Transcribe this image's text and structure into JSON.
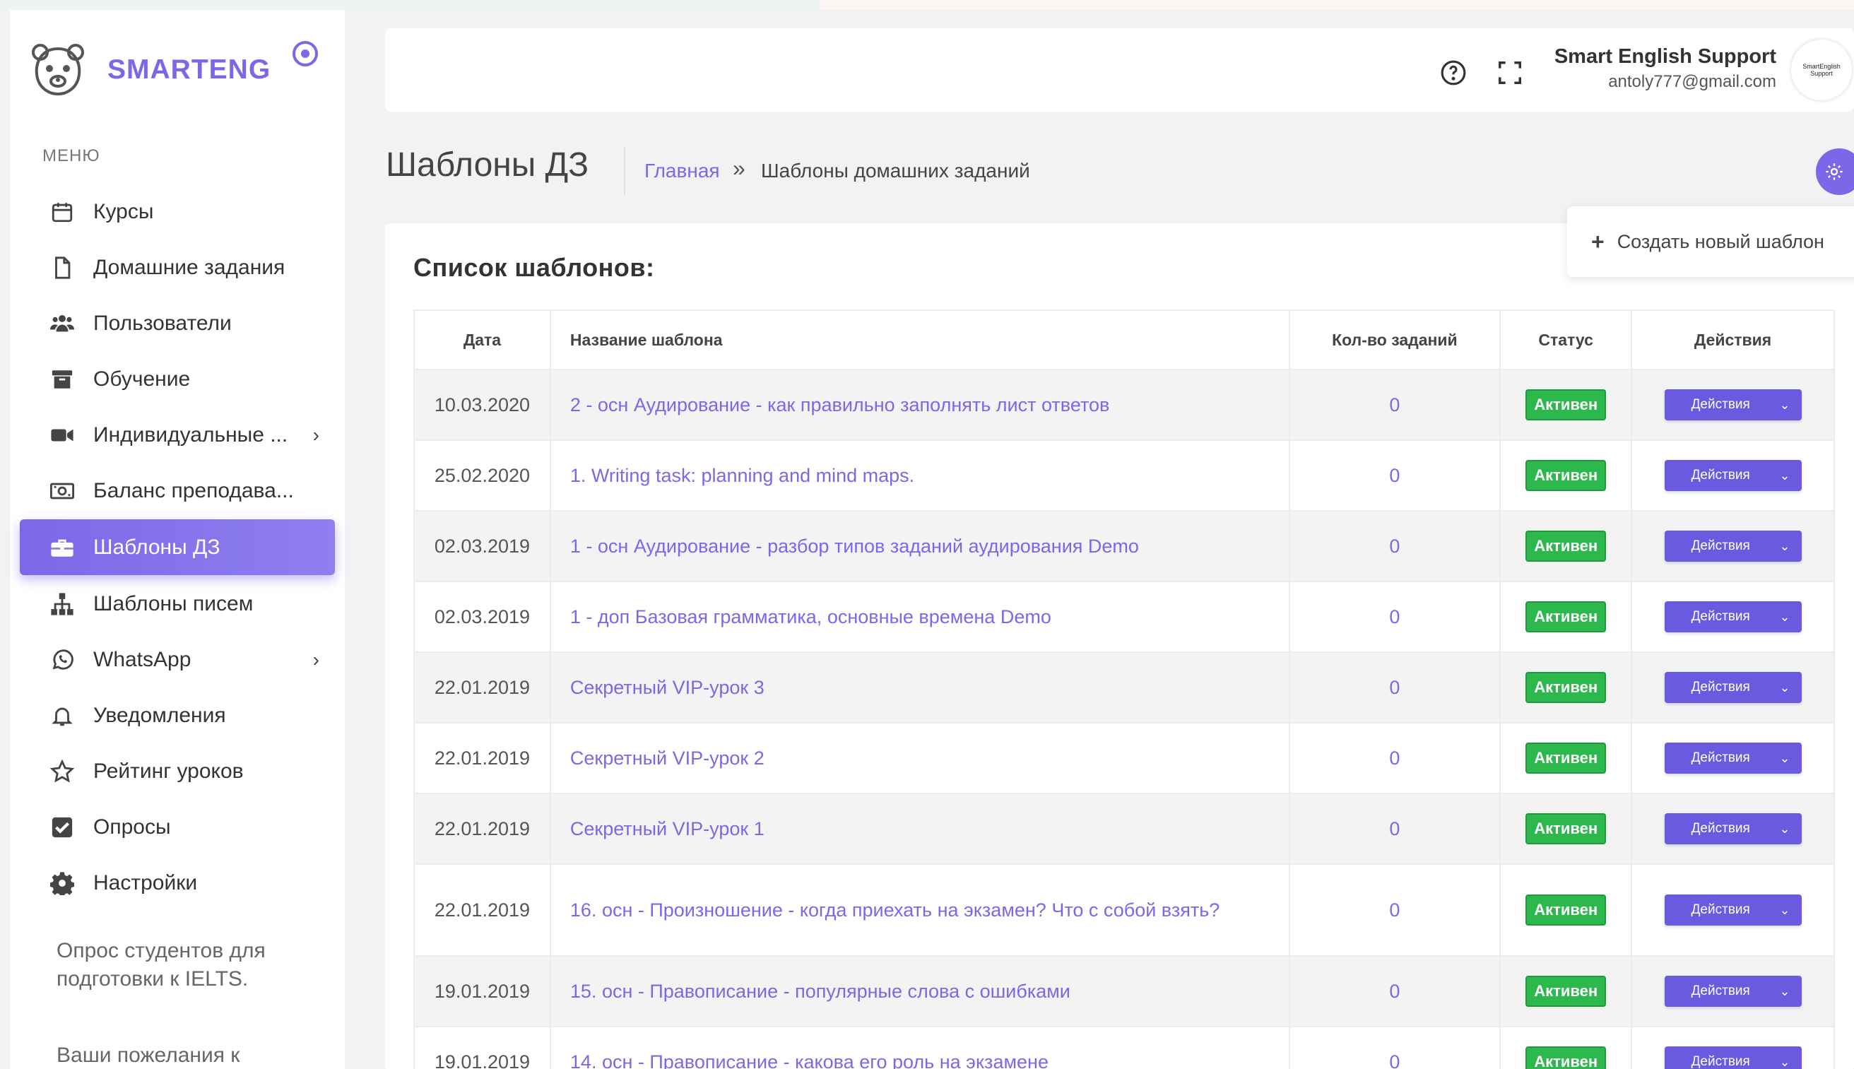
{
  "brand": {
    "name": "SMARTENG"
  },
  "sidebar": {
    "menu_title": "МЕНЮ",
    "items": [
      {
        "label": "Курсы",
        "icon": "calendar-icon",
        "chevron": ""
      },
      {
        "label": "Домашние задания",
        "icon": "file-icon",
        "chevron": ""
      },
      {
        "label": "Пользователи",
        "icon": "users-icon",
        "chevron": ""
      },
      {
        "label": "Обучение",
        "icon": "archive-icon",
        "chevron": ""
      },
      {
        "label": "Индивидуальные ...",
        "icon": "video-icon",
        "chevron": "›"
      },
      {
        "label": "Баланс преподава...",
        "icon": "money-icon",
        "chevron": ""
      },
      {
        "label": "Шаблоны ДЗ",
        "icon": "briefcase-icon",
        "chevron": "",
        "active": true
      },
      {
        "label": "Шаблоны писем",
        "icon": "sitemap-icon",
        "chevron": ""
      },
      {
        "label": "WhatsApp",
        "icon": "whatsapp-icon",
        "chevron": "›"
      },
      {
        "label": "Уведомления",
        "icon": "bell-icon",
        "chevron": ""
      },
      {
        "label": "Рейтинг уроков",
        "icon": "star-icon",
        "chevron": ""
      },
      {
        "label": "Опросы",
        "icon": "checkbox-icon",
        "chevron": ""
      },
      {
        "label": "Настройки",
        "icon": "gear-icon",
        "chevron": ""
      }
    ],
    "extra_links": [
      "Опрос студентов для подготовки к IELTS.",
      "Ваши пожелания к"
    ]
  },
  "header": {
    "user_name": "Smart English Support",
    "user_email": "antoly777@gmail.com",
    "avatar_text": "SmartEnglish Support"
  },
  "page": {
    "title": "Шаблоны ДЗ",
    "breadcrumb_home": "Главная",
    "breadcrumb_sep": "»",
    "breadcrumb_current": "Шаблоны домашних заданий",
    "create_template_label": "Создать новый шаблон",
    "list_title": "Список шаблонов:"
  },
  "table": {
    "columns": [
      "Дата",
      "Название шаблона",
      "Кол-во заданий",
      "Статус",
      "Действия"
    ],
    "action_label": "Действия",
    "rows": [
      {
        "date": "10.03.2020",
        "name": "2 - осн Аудирование - как правильно заполнять лист ответов",
        "count": "0",
        "status": "Активен"
      },
      {
        "date": "25.02.2020",
        "name": "1. Writing task: planning and mind maps.",
        "count": "0",
        "status": "Активен"
      },
      {
        "date": "02.03.2019",
        "name": "1 - осн Аудирование - разбор типов заданий аудирования Demo",
        "count": "0",
        "status": "Активен"
      },
      {
        "date": "02.03.2019",
        "name": "1 - доп Базовая грамматика, основные времена Demo",
        "count": "0",
        "status": "Активен"
      },
      {
        "date": "22.01.2019",
        "name": "Секретный VIP-урок 3",
        "count": "0",
        "status": "Активен"
      },
      {
        "date": "22.01.2019",
        "name": "Секретный VIP-урок 2",
        "count": "0",
        "status": "Активен"
      },
      {
        "date": "22.01.2019",
        "name": "Секретный VIP-урок 1",
        "count": "0",
        "status": "Активен"
      },
      {
        "date": "22.01.2019",
        "name": "16. осн - Произношение - когда приехать на экзамен? Что с собой взять?",
        "count": "0",
        "status": "Активен"
      },
      {
        "date": "19.01.2019",
        "name": "15. осн - Правописание - популярные слова с ошибками",
        "count": "0",
        "status": "Активен"
      },
      {
        "date": "19.01.2019",
        "name": "14. осн - Правописание - какова его роль на экзамене",
        "count": "0",
        "status": "Активен"
      }
    ]
  },
  "colors": {
    "accent": "#7b68e8",
    "success": "#2db84d",
    "button": "#6a5ae0"
  }
}
